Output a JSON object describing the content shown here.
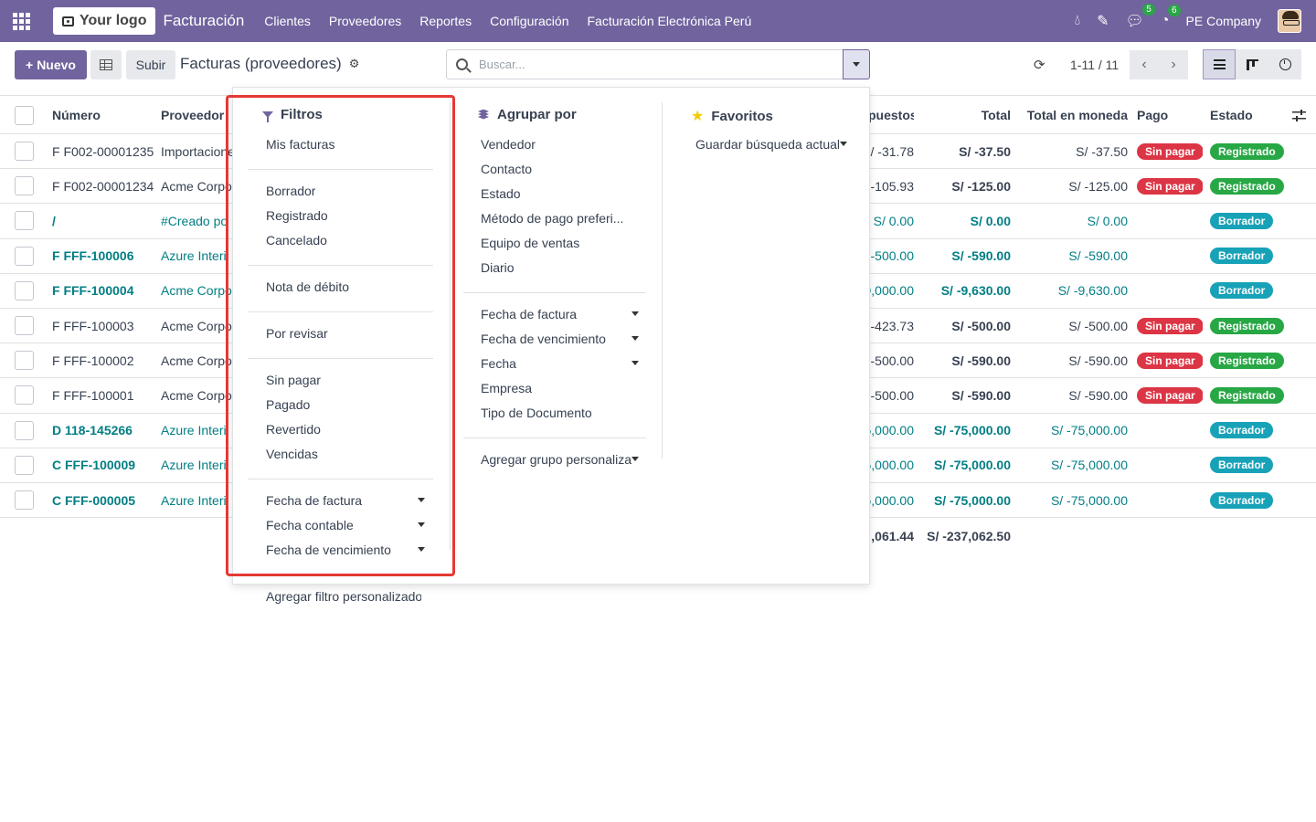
{
  "navbar": {
    "logo_text": "Your logo",
    "app_name": "Facturación",
    "menu": [
      "Clientes",
      "Proveedores",
      "Reportes",
      "Configuración",
      "Facturación Electrónica Perú"
    ],
    "messages_badge": "5",
    "activities_badge": "6",
    "company": "PE Company"
  },
  "control": {
    "new_label": "Nuevo",
    "upload_label": "Subir",
    "breadcrumb": "Facturas (proveedores)",
    "search_placeholder": "Buscar...",
    "pager": "1-11 / 11"
  },
  "table": {
    "headers": {
      "number": "Número",
      "partner": "Proveedor",
      "taxes": "puestos",
      "total": "Total",
      "total_currency": "Total en moneda",
      "payment": "Pago",
      "state": "Estado"
    },
    "rows": [
      {
        "number": "F F002-00001235",
        "partner": "Importacione",
        "taxes": "/ -31.78",
        "total": "S/ -37.50",
        "currency": "S/ -37.50",
        "payment": "Sin pagar",
        "state": "Registrado",
        "bold_num": false,
        "link_partner": false
      },
      {
        "number": "F F002-00001234",
        "partner": "Acme Corpo",
        "taxes": "-105.93",
        "total": "S/ -125.00",
        "currency": "S/ -125.00",
        "payment": "Sin pagar",
        "state": "Registrado",
        "bold_num": false,
        "link_partner": false
      },
      {
        "number": "/",
        "partner": "#Creado po",
        "taxes": "S/ 0.00",
        "total": "S/ 0.00",
        "currency": "S/ 0.00",
        "payment": "",
        "state": "Borrador",
        "bold_num": true,
        "link_partner": true
      },
      {
        "number": "F FFF-100006",
        "partner": "Azure Interi",
        "taxes": "-500.00",
        "total": "S/ -590.00",
        "currency": "S/ -590.00",
        "payment": "",
        "state": "Borrador",
        "bold_num": true,
        "link_partner": true
      },
      {
        "number": "F FFF-100004",
        "partner": "Acme Corpo",
        "taxes": "9,000.00",
        "total": "S/ -9,630.00",
        "currency": "S/ -9,630.00",
        "payment": "",
        "state": "Borrador",
        "bold_num": true,
        "link_partner": true
      },
      {
        "number": "F FFF-100003",
        "partner": "Acme Corpo",
        "taxes": "-423.73",
        "total": "S/ -500.00",
        "currency": "S/ -500.00",
        "payment": "Sin pagar",
        "state": "Registrado",
        "bold_num": false,
        "link_partner": false
      },
      {
        "number": "F FFF-100002",
        "partner": "Acme Corpo",
        "taxes": "-500.00",
        "total": "S/ -590.00",
        "currency": "S/ -590.00",
        "payment": "Sin pagar",
        "state": "Registrado",
        "bold_num": false,
        "link_partner": false
      },
      {
        "number": "F FFF-100001",
        "partner": "Acme Corpo",
        "taxes": "-500.00",
        "total": "S/ -590.00",
        "currency": "S/ -590.00",
        "payment": "Sin pagar",
        "state": "Registrado",
        "bold_num": false,
        "link_partner": false
      },
      {
        "number": "D 118-145266",
        "partner": "Azure Interi",
        "taxes": "5,000.00",
        "total": "S/ -75,000.00",
        "currency": "S/ -75,000.00",
        "payment": "",
        "state": "Borrador",
        "bold_num": true,
        "link_partner": true
      },
      {
        "number": "C FFF-100009",
        "partner": "Azure Interi",
        "taxes": "5,000.00",
        "total": "S/ -75,000.00",
        "currency": "S/ -75,000.00",
        "payment": "",
        "state": "Borrador",
        "bold_num": true,
        "link_partner": true
      },
      {
        "number": "C FFF-000005",
        "partner": "Azure Interi",
        "taxes": "5,000.00",
        "total": "S/ -75,000.00",
        "currency": "S/ -75,000.00",
        "payment": "",
        "state": "Borrador",
        "bold_num": true,
        "link_partner": true
      }
    ],
    "totals": {
      "taxes": ",061.44",
      "total": "S/ -237,062.50"
    }
  },
  "dropdown": {
    "filters": {
      "title": "Filtros",
      "groups": [
        [
          "Mis facturas"
        ],
        [
          "Borrador",
          "Registrado",
          "Cancelado"
        ],
        [
          "Nota de débito"
        ],
        [
          "Por revisar"
        ],
        [
          "Sin pagar",
          "Pagado",
          "Revertido",
          "Vencidas"
        ],
        [
          "Fecha de factura",
          "Fecha contable",
          "Fecha de vencimiento"
        ],
        [
          "Agregar filtro personalizado"
        ]
      ]
    },
    "groupby": {
      "title": "Agrupar por",
      "groups": [
        [
          "Vendedor",
          "Contacto",
          "Estado",
          "Método de pago preferi...",
          "Equipo de ventas",
          "Diario"
        ],
        [
          "Fecha de factura",
          "Fecha de vencimiento",
          "Fecha",
          "Empresa",
          "Tipo de Documento"
        ],
        [
          "Agregar grupo personaliza"
        ]
      ]
    },
    "favorites": {
      "title": "Favoritos",
      "save_label": "Guardar búsqueda actual"
    }
  },
  "colors": {
    "brand": "#71639e",
    "link": "#017e84",
    "danger": "#dc3545",
    "success": "#28a745",
    "info": "#17a2b8",
    "highlight": "#e53935"
  }
}
